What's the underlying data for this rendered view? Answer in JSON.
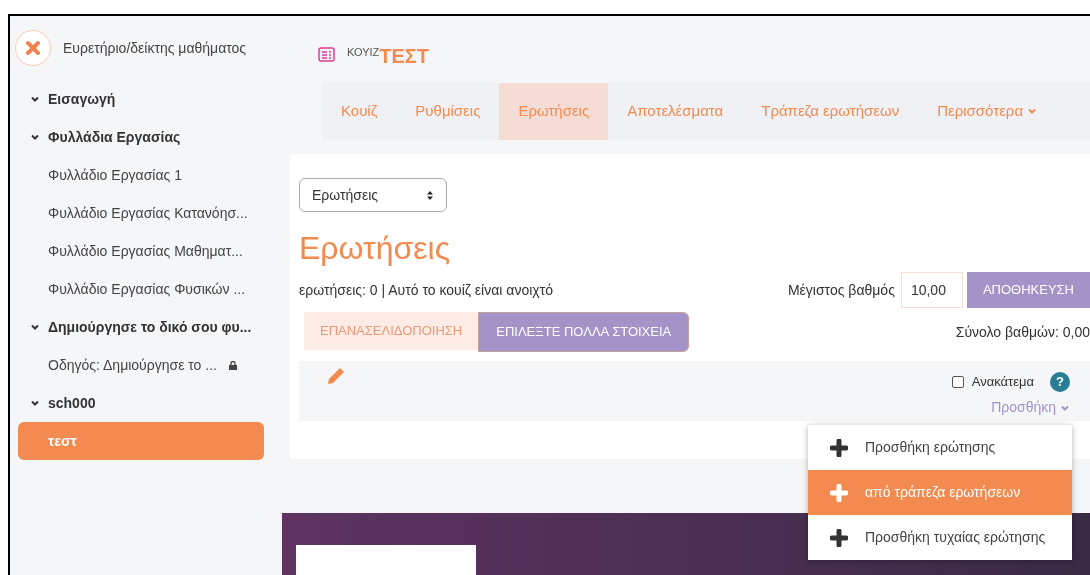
{
  "sidebar": {
    "title": "Ευρετήριο/δείκτης μαθήματος",
    "items": [
      {
        "label": "Εισαγωγή",
        "expanded": true,
        "selected": false
      },
      {
        "label": "Φυλλάδια Εργασίας",
        "expanded": true,
        "selected": false,
        "children": [
          {
            "label": "Φυλλάδιο Εργασίας 1",
            "locked": false,
            "selected": false
          },
          {
            "label": "Φυλλάδιο Εργασίας Κατανόησ...",
            "locked": false,
            "selected": false
          },
          {
            "label": "Φυλλάδιο Εργασίας Μαθηματ...",
            "locked": false,
            "selected": false
          },
          {
            "label": "Φυλλάδιο Εργασίας Φυσικών ...",
            "locked": false,
            "selected": false
          }
        ]
      },
      {
        "label": "Δημιούργησε το δικό σου φυ...",
        "expanded": true,
        "selected": false,
        "children": [
          {
            "label": "Οδηγός: Δημιούργησε το ...",
            "locked": true,
            "selected": false
          }
        ]
      },
      {
        "label": "sch000",
        "expanded": true,
        "selected": false,
        "children": [
          {
            "label": "τεστ",
            "locked": false,
            "selected": true
          }
        ]
      }
    ]
  },
  "header": {
    "type_label": "ΚΟΥΙΖ",
    "title": "ΤΕΣΤ"
  },
  "tabs": [
    {
      "label": "Κουίζ",
      "selected": false
    },
    {
      "label": "Ρυθμίσεις",
      "selected": false
    },
    {
      "label": "Ερωτήσεις",
      "selected": true
    },
    {
      "label": "Αποτελέσματα",
      "selected": false
    },
    {
      "label": "Τράπεζα ερωτήσεων",
      "selected": false
    },
    {
      "label": "Περισσότερα",
      "selected": false,
      "dropdown": true
    }
  ],
  "select": {
    "value": "Ερωτήσεις"
  },
  "heading": "Ερωτήσεις",
  "info": "ερωτήσεις: 0 | Αυτό το κουίζ είναι ανοιχτό",
  "max_grade": {
    "label": "Μέγιστος βαθμός",
    "value": "10,00",
    "button": "ΑΠΟΘΗΚΕΥΣΗ"
  },
  "repaginate": {
    "label": "ΕΠΑΝΑΣΕΛΙΔΟΠΟΙΗΣΗ",
    "disabled": true
  },
  "select_multiple": "ΕΠΙΛΕΞΤΕ ΠΟΛΛΑ ΣΤΟΙΧΕΙΑ",
  "total": "Σύνολο βαθμών: 0,00",
  "shuffle": {
    "label": "Ανακάτεμα",
    "checked": false
  },
  "help": "?",
  "add": {
    "label": "Προσθήκη",
    "expanded": true,
    "menu": [
      {
        "label": "Προσθήκη ερώτησης",
        "selected": false
      },
      {
        "label": "από τράπεζα ερωτήσεων",
        "selected": true
      },
      {
        "label": "Προσθήκη τυχαίας ερώτησης",
        "selected": false
      }
    ]
  }
}
